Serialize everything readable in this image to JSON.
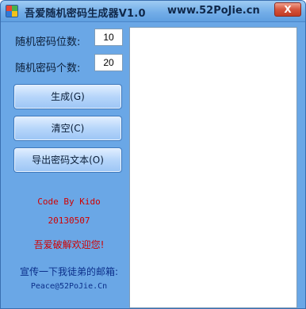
{
  "window": {
    "title": "吾爱随机密码生成器V1.0",
    "title_url": "www.52PoJie.cn",
    "close_label": "X"
  },
  "form": {
    "length_label": "随机密码位数:",
    "length_value": "10",
    "count_label": "随机密码个数:",
    "count_value": "20"
  },
  "buttons": {
    "generate": "生成(G)",
    "clear": "清空(C)",
    "export": "导出密码文本(O)"
  },
  "credits": {
    "code_by": "Code By Kido",
    "date": "20130507",
    "welcome": "吾爱破解欢迎您!",
    "promo": "宣传一下我徒弟的邮箱:",
    "email": "Peace@52PoJie.Cn"
  },
  "colors": {
    "background": "#6aa7e6",
    "credit_red": "#d10000",
    "promo_blue": "#0b2f8a"
  }
}
